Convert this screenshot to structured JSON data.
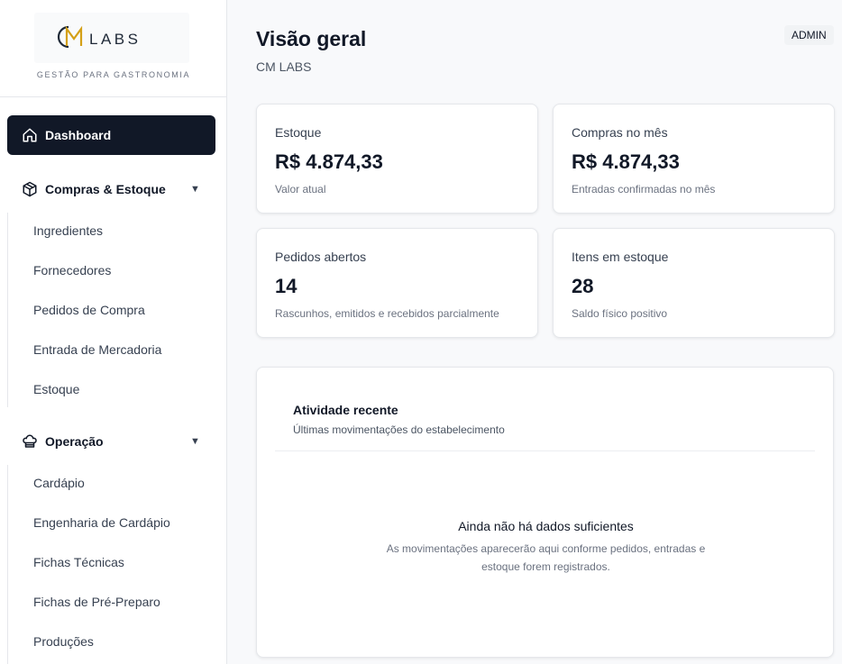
{
  "brand": {
    "logo_text": "CM LABS",
    "tagline": "GESTÃO PARA GASTRONOMIA"
  },
  "sidebar": {
    "dashboard": {
      "label": "Dashboard",
      "icon": "home-icon",
      "active": true
    },
    "groups": [
      {
        "label": "Compras & Estoque",
        "icon": "box-icon",
        "expanded": true,
        "items": [
          "Ingredientes",
          "Fornecedores",
          "Pedidos de Compra",
          "Entrada de Mercadoria",
          "Estoque"
        ]
      },
      {
        "label": "Operação",
        "icon": "chef-hat-icon",
        "expanded": true,
        "items": [
          "Cardápio",
          "Engenharia de Cardápio",
          "Fichas Técnicas",
          "Fichas de Pré-Preparo",
          "Produções"
        ]
      }
    ],
    "chevron_glyph": "▼"
  },
  "header": {
    "title": "Visão geral",
    "subtitle": "CM LABS",
    "role_badge": "ADMIN"
  },
  "cards": [
    {
      "label": "Estoque",
      "value": "R$ 4.874,33",
      "hint": "Valor atual"
    },
    {
      "label": "Compras no mês",
      "value": "R$ 4.874,33",
      "hint": "Entradas confirmadas no mês"
    },
    {
      "label": "Pedidos abertos",
      "value": "14",
      "hint": "Rascunhos, emitidos e recebidos parcialmente"
    },
    {
      "label": "Itens em estoque",
      "value": "28",
      "hint": "Saldo físico positivo"
    }
  ],
  "activity": {
    "title": "Atividade recente",
    "subtitle": "Últimas movimentações do estabelecimento",
    "empty_title": "Ainda não há dados suficientes",
    "empty_desc": "As movimentações aparecerão aqui conforme pedidos, entradas e estoque forem registrados."
  },
  "colors": {
    "accent": "#111827",
    "background": "#f8f9fb",
    "card": "#ffffff",
    "border": "#e5e7eb",
    "muted_text": "#6b7280"
  }
}
